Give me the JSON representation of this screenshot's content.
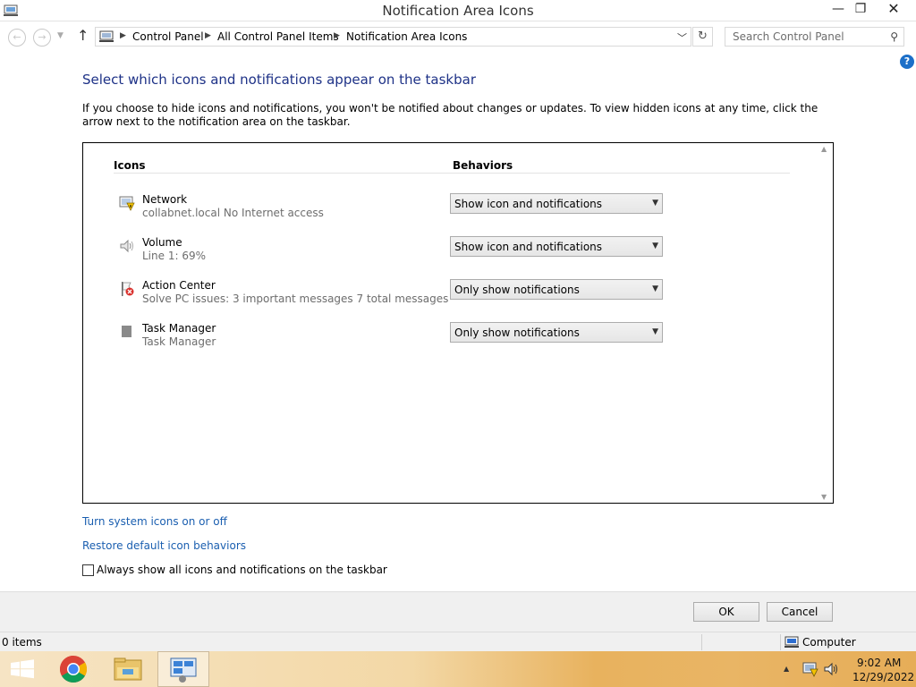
{
  "window": {
    "title": "Notification Area Icons",
    "minimize_glyph": "—",
    "maximize_glyph": "❐",
    "close_glyph": "✕"
  },
  "nav": {
    "breadcrumbs": [
      "Control Panel",
      "All Control Panel Items",
      "Notification Area Icons"
    ],
    "search_placeholder": "Search Control Panel"
  },
  "content": {
    "heading": "Select which icons and notifications appear on the taskbar",
    "description": "If you choose to hide icons and notifications, you won't be notified about changes or updates. To view hidden icons at any time, click the arrow next to the notification area on the taskbar.",
    "col_icons": "Icons",
    "col_behaviors": "Behaviors",
    "rows": [
      {
        "name": "Network",
        "detail": "collabnet.local No Internet access",
        "behavior": "Show icon and notifications",
        "icon": "network-warning-icon"
      },
      {
        "name": "Volume",
        "detail": "Line 1: 69%",
        "behavior": "Show icon and notifications",
        "icon": "speaker-icon"
      },
      {
        "name": "Action Center",
        "detail": "Solve PC issues: 3 important messages  7 total messages",
        "behavior": "Only show notifications",
        "icon": "action-center-flag-icon"
      },
      {
        "name": "Task Manager",
        "detail": "Task Manager",
        "behavior": "Only show notifications",
        "icon": "task-manager-icon"
      }
    ],
    "link_system_icons": "Turn system icons on or off",
    "link_restore": "Restore default icon behaviors",
    "always_show_label": "Always show all icons and notifications on the taskbar",
    "always_show_checked": false
  },
  "buttons": {
    "ok": "OK",
    "cancel": "Cancel"
  },
  "statusbar": {
    "items": "0 items",
    "location": "Computer"
  },
  "taskbar": {
    "apps": [
      "start-button",
      "chrome-icon",
      "file-explorer-icon",
      "control-panel-icon"
    ],
    "time": "9:02 AM",
    "date": "12/29/2022"
  },
  "colors": {
    "heading": "#1e3287",
    "link": "#1b5fb0",
    "help": "#1c6fc8"
  }
}
